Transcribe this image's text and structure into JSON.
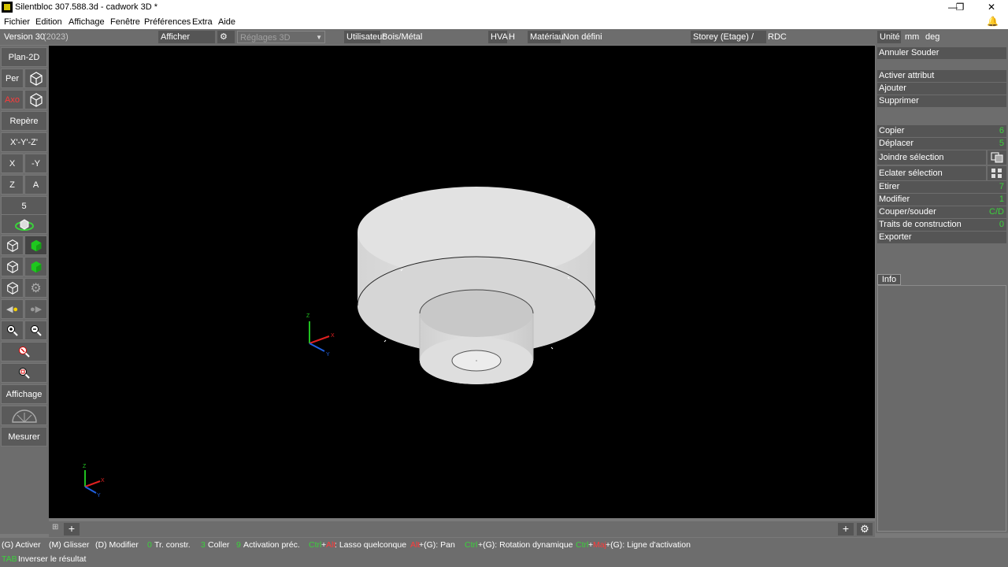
{
  "window": {
    "title": "Silentbloc 307.588.3d - cadwork 3D *"
  },
  "menu": [
    "Fichier",
    "Edition",
    "Affichage",
    "Fenêtre",
    "Préférences",
    "Extra",
    "Aide"
  ],
  "topbar": {
    "version": "Version 30",
    "year": "(2023)",
    "show_attribute": "Afficher attribut",
    "settings_3d": "Réglages 3D",
    "user_label": "Utilisateur",
    "user_value": "Bois/Métal",
    "hva_label": "HVA",
    "hva_value": "H",
    "material_label": "Matériau",
    "material_value": "Non défini",
    "storey_label": "Storey (Etage) / IFC",
    "storey_value": "RDC",
    "unit_label": "Unité",
    "unit_length": "mm",
    "unit_angle": "deg"
  },
  "left_toolbar": {
    "plan2d": "Plan-2D",
    "per": "Per",
    "axo": "Axo",
    "repere": "Repère",
    "xyz": "X'-Y'-Z'",
    "x": "X",
    "neg_y": "-Y",
    "z": "Z",
    "a": "A",
    "five": "5",
    "affichage": "Affichage",
    "mesurer": "Mesurer"
  },
  "right_panel": {
    "annuler_souder": "Annuler Souder",
    "activer_attribut": "Activer attribut",
    "ajouter": "Ajouter",
    "supprimer": "Supprimer",
    "copier": "Copier",
    "copier_key": "6",
    "deplacer": "Déplacer",
    "deplacer_key": "5",
    "joindre": "Joindre sélection",
    "eclater": "Eclater sélection",
    "etirer": "Etirer",
    "etirer_key": "7",
    "modifier": "Modifier",
    "modifier_key": "1",
    "couper": "Couper/souder",
    "couper_key": "C/D",
    "traits": "Traits de construction",
    "traits_key": "0",
    "exporter": "Exporter",
    "info_tab": "Info"
  },
  "axes": {
    "x": "X",
    "y": "Y",
    "z": "Z"
  },
  "status": {
    "s1": "(G) Activer",
    "s2": "(M) Glisser",
    "s3": "(D) Modifier",
    "s4k": "0",
    "s4": "Tr. constr.",
    "s5k": "3",
    "s5": "Coller",
    "s6k": "9",
    "s6": "Activation préc.",
    "s7k1": "Ctrl",
    "s7k2": "+",
    "s7k3": "Alt",
    "s7": ": Lasso quelconque",
    "s8k": "Alt",
    "s8": "+(G): Pan",
    "s9k": "Ctrl",
    "s9": "+(G): Rotation dynamique",
    "s10k1": "Ctrl",
    "s10k2": "+",
    "s10k3": "Maj",
    "s10": "+(G): Ligne d'activation",
    "tab_key": "TAB",
    "tab_text": "Inverser le résultat"
  },
  "colors": {
    "panel": "#6d6d6d",
    "button": "#555555",
    "viewport": "#000000",
    "accent_green": "#3bd23b",
    "accent_red": "#ff3a3a"
  }
}
